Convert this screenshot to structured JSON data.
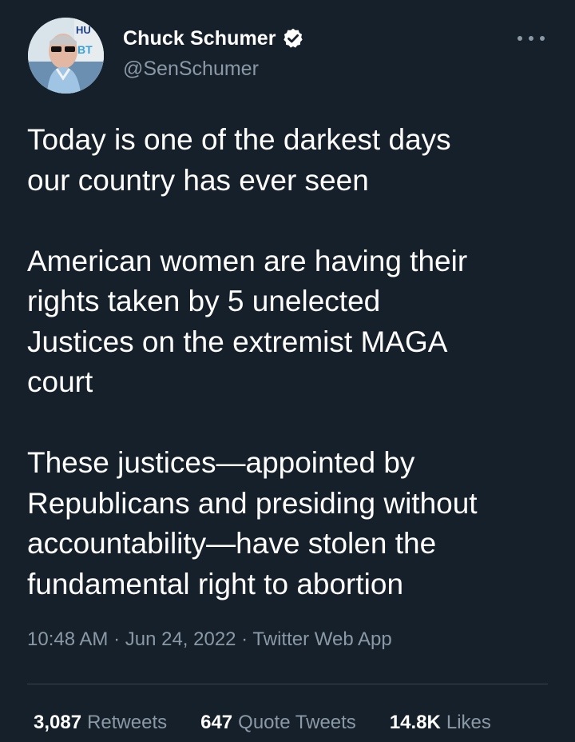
{
  "tweet": {
    "author": {
      "display_name": "Chuck Schumer",
      "handle": "@SenSchumer",
      "verified_icon": "verified-badge-icon",
      "avatar_sign_text": "HU BT"
    },
    "text_paragraphs": [
      "Today is one of the darkest days\nour country has ever seen",
      "American women are having their\nrights taken by 5 unelected\nJustices on the extremist MAGA\ncourt",
      "These justices—appointed by\nRepublicans and presiding without\naccountability—have stolen the\nfundamental right to abortion"
    ],
    "meta": "10:48 AM · Jun 24, 2022 · Twitter Web App",
    "stats": {
      "retweets": {
        "count": "3,087",
        "label": "Retweets"
      },
      "quote_tweets": {
        "count": "647",
        "label": "Quote Tweets"
      },
      "likes": {
        "count": "14.8K",
        "label": "Likes"
      }
    },
    "more_icon": "more-options-icon"
  },
  "colors": {
    "background": "#15202b",
    "text_primary": "#ffffff",
    "text_secondary": "#8b98a5",
    "divider": "#38444d"
  }
}
